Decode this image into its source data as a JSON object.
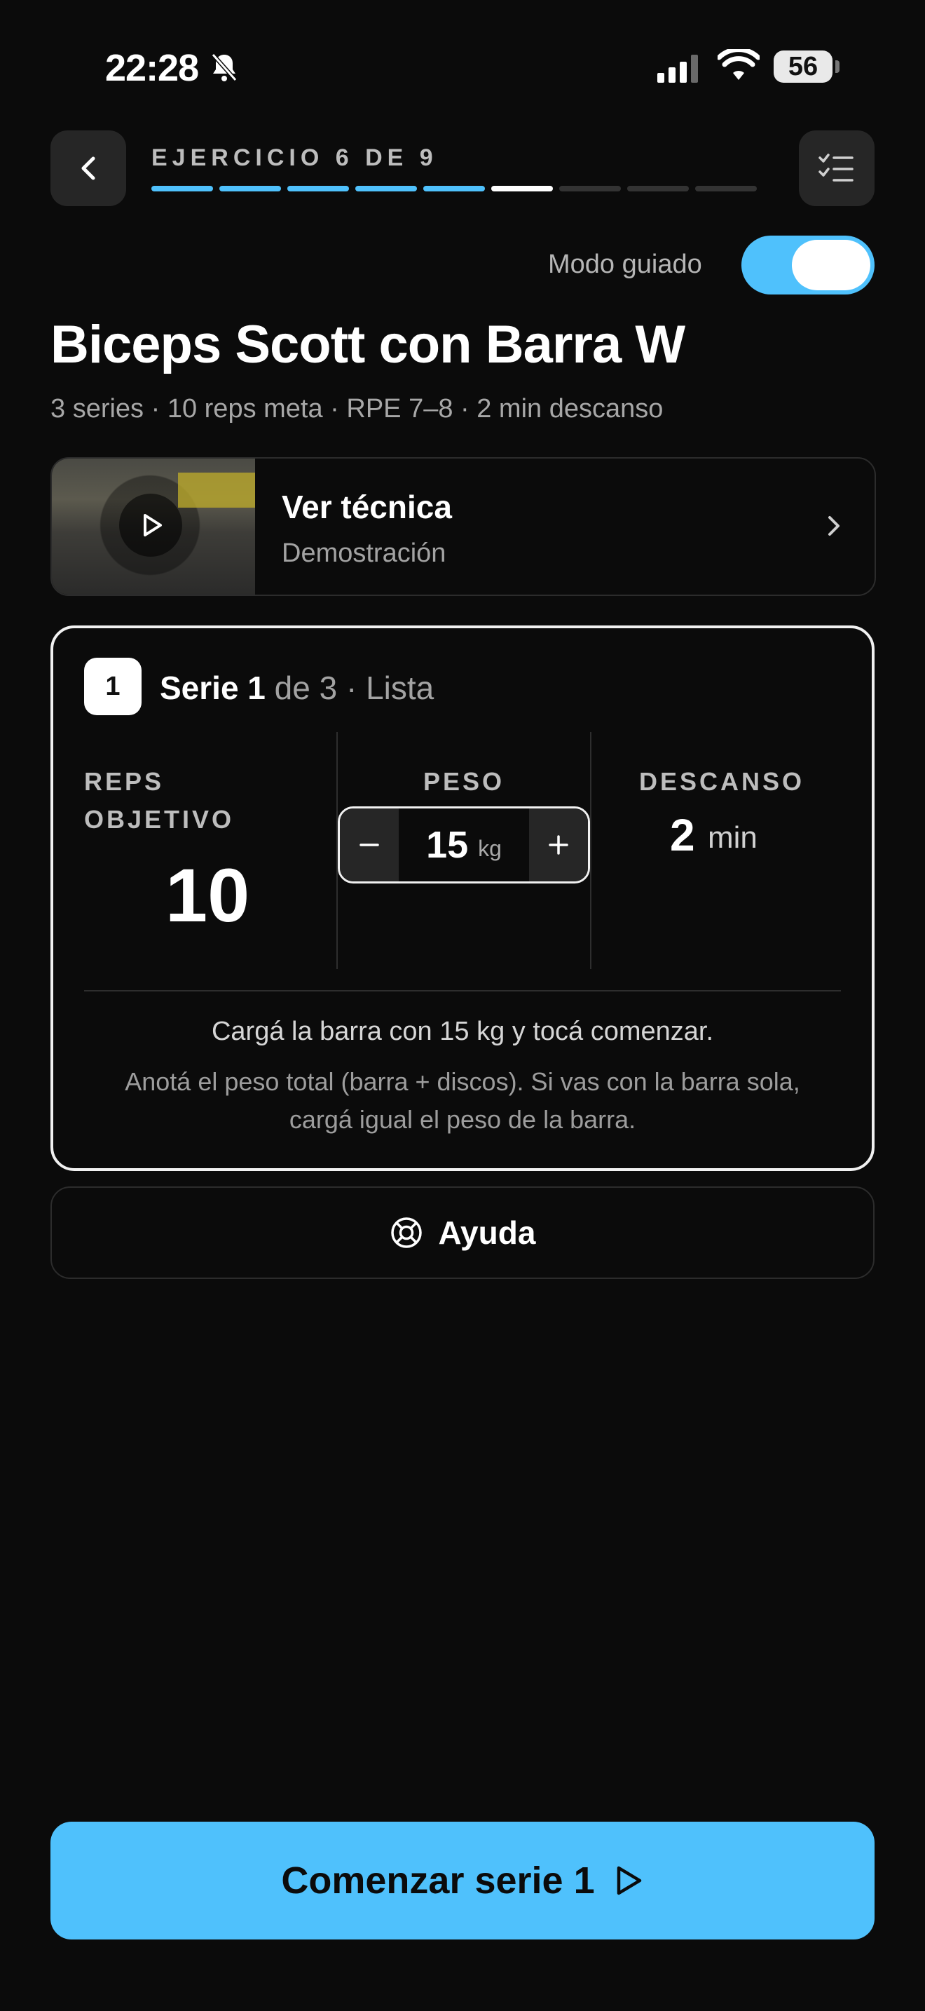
{
  "status_bar": {
    "time": "22:28",
    "battery": "56"
  },
  "header": {
    "exercise_progress_label": "EJERCICIO 6 DE 9",
    "current_exercise": 6,
    "total_exercises": 9
  },
  "guided_mode": {
    "label": "Modo guiado",
    "enabled": true
  },
  "exercise": {
    "title": "Biceps Scott con Barra W",
    "subtitle": "3 series · 10 reps meta · RPE 7–8 · 2 min descanso"
  },
  "technique": {
    "title": "Ver técnica",
    "subtitle": "Demostración"
  },
  "set": {
    "badge": "1",
    "label": "Serie 1",
    "of_total": " de 3 · Lista",
    "reps_label": "REPS OBJETIVO",
    "reps_value": "10",
    "weight_label": "PESO",
    "weight_value": "15",
    "weight_unit": "kg",
    "rest_label": "DESCANSO",
    "rest_value": "2",
    "rest_unit": "min",
    "instruction": "Cargá la barra con 15 kg y tocá comenzar.",
    "note": "Anotá el peso total (barra + discos). Si vas con la barra sola, cargá igual el peso de la barra."
  },
  "help": {
    "label": "Ayuda"
  },
  "cta": {
    "label": "Comenzar serie 1"
  },
  "colors": {
    "accent": "#4fc1fc",
    "background": "#0b0b0b"
  },
  "icons": [
    "bell-slash-icon",
    "signal-icon",
    "wifi-icon",
    "battery-icon",
    "back-chevron-icon",
    "checklist-icon",
    "play-icon",
    "chevron-right-icon",
    "minus-icon",
    "plus-icon",
    "lifebuoy-icon",
    "play-outline-icon"
  ]
}
